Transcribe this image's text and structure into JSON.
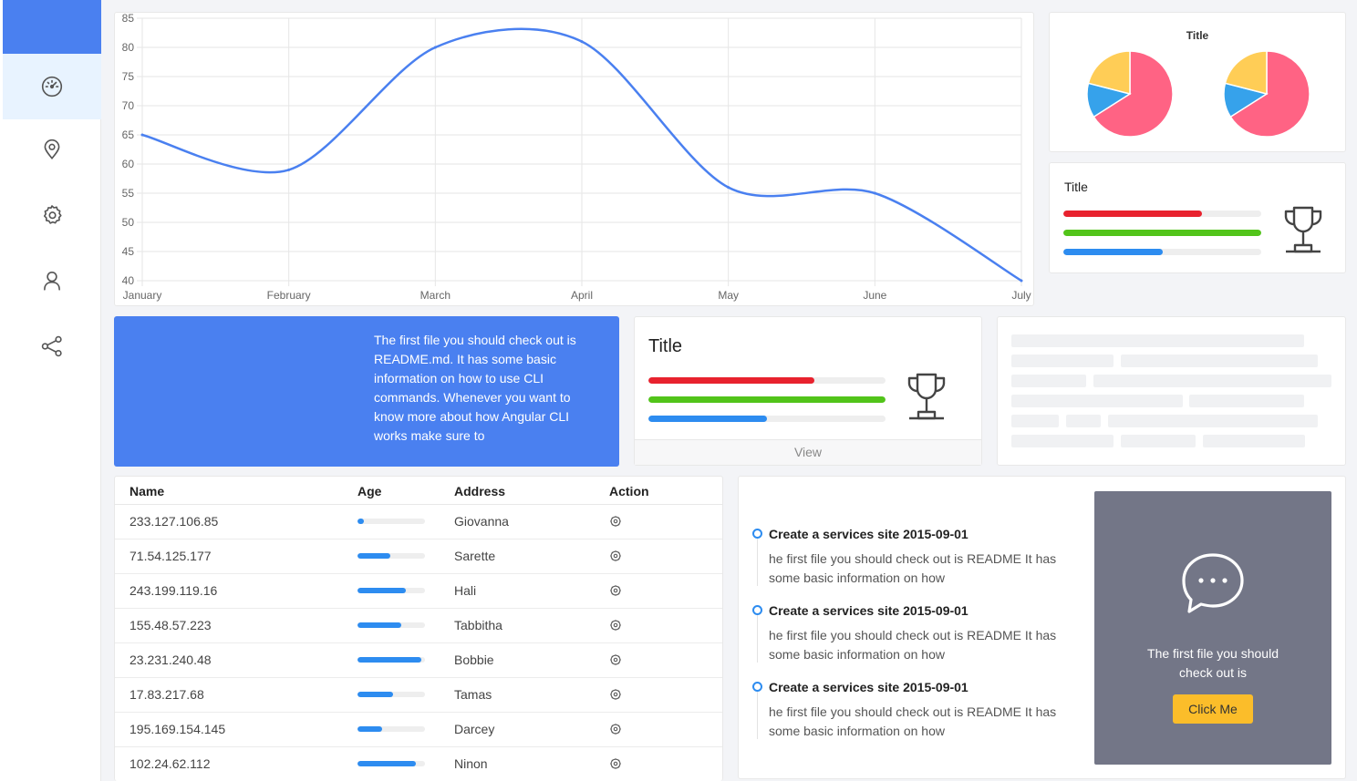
{
  "sidebar": {
    "items": [
      {
        "icon": "dashboard-icon",
        "active": true
      },
      {
        "icon": "location-icon",
        "active": false
      },
      {
        "icon": "gear-icon",
        "active": false
      },
      {
        "icon": "user-icon",
        "active": false
      },
      {
        "icon": "share-icon",
        "active": false
      }
    ],
    "accent": "#4a80f0"
  },
  "chart_data": [
    {
      "type": "line",
      "title": "",
      "categories": [
        "January",
        "February",
        "March",
        "April",
        "May",
        "June",
        "July"
      ],
      "series": [
        {
          "values": [
            65,
            59,
            80,
            81,
            56,
            55,
            40
          ],
          "color": "#4a80f0"
        }
      ],
      "yticks": [
        "85",
        "80",
        "75",
        "70",
        "65",
        "60",
        "55",
        "50",
        "45",
        "40"
      ],
      "ylim": [
        40,
        85
      ],
      "grid": true
    },
    {
      "type": "pie",
      "title": "Title",
      "values": [
        66,
        13,
        21
      ],
      "colors": [
        "#ff6384",
        "#36a2eb",
        "#ffcd56"
      ]
    },
    {
      "type": "pie",
      "title": "",
      "values": [
        66,
        13,
        21
      ],
      "colors": [
        "#ff6384",
        "#36a2eb",
        "#ffcd56"
      ]
    }
  ],
  "progress_card": {
    "title": "Title",
    "bars": [
      {
        "value": 70,
        "color": "#e8222e"
      },
      {
        "value": 100,
        "color": "#52c41a"
      },
      {
        "value": 50,
        "color": "#2d8cf0"
      }
    ]
  },
  "banner": {
    "text": "The first file you should check out is README.md. It has some basic information on how to use CLI commands. Whenever you want to know more about how Angular CLI works make sure to"
  },
  "title_card": {
    "title": "Title",
    "view_label": "View",
    "bars": [
      {
        "value": 70,
        "color": "#e8222e"
      },
      {
        "value": 100,
        "color": "#52c41a"
      },
      {
        "value": 50,
        "color": "#2d8cf0"
      }
    ]
  },
  "table": {
    "headers": [
      "Name",
      "Age",
      "Address",
      "Action"
    ],
    "rows": [
      {
        "name": "233.127.106.85",
        "age": 10,
        "address": "Giovanna"
      },
      {
        "name": "71.54.125.177",
        "age": 48,
        "address": "Sarette"
      },
      {
        "name": "243.199.119.16",
        "age": 72,
        "address": "Hali"
      },
      {
        "name": "155.48.57.223",
        "age": 65,
        "address": "Tabbitha"
      },
      {
        "name": "23.231.240.48",
        "age": 95,
        "address": "Bobbie"
      },
      {
        "name": "17.83.217.68",
        "age": 53,
        "address": "Tamas"
      },
      {
        "name": "195.169.154.145",
        "age": 36,
        "address": "Darcey"
      },
      {
        "name": "102.24.62.112",
        "age": 86,
        "address": "Ninon"
      }
    ]
  },
  "timeline": {
    "items": [
      {
        "title": "Create a services site 2015-09-01",
        "body": "he first file you should check out is README It has some basic information on how"
      },
      {
        "title": "Create a services site 2015-09-01",
        "body": "he first file you should check out is README It has some basic information on how"
      },
      {
        "title": "Create a services site 2015-09-01",
        "body": "he first file you should check out is README It has some basic information on how"
      }
    ]
  },
  "chat_panel": {
    "text": "The first file you should check out is",
    "button_label": "Click Me"
  }
}
